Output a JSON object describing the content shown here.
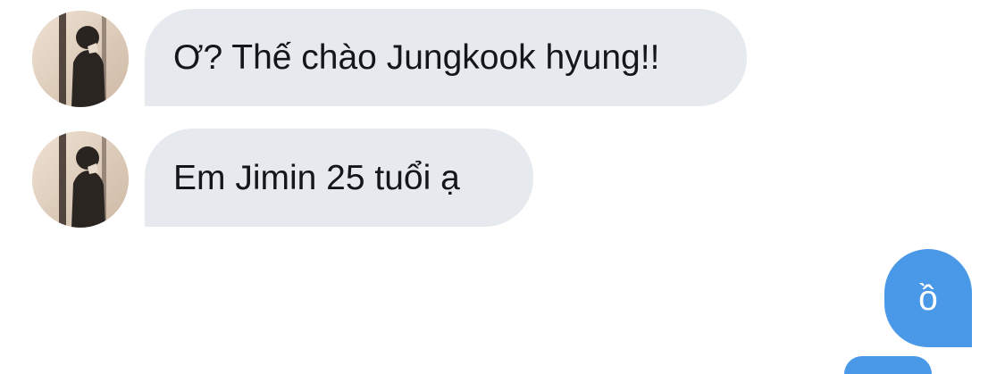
{
  "conversation": {
    "messages": [
      {
        "direction": "incoming",
        "text": "Ơ? Thế chào Jungkook hyung!!",
        "avatar": "user-avatar-photo"
      },
      {
        "direction": "incoming",
        "text": "Em Jimin 25 tuổi ạ",
        "avatar": "user-avatar-photo"
      },
      {
        "direction": "outgoing",
        "text": "ồ"
      }
    ]
  },
  "colors": {
    "incoming_bubble": "#e6e9ee",
    "outgoing_bubble": "#4a99e9",
    "incoming_text": "#14171a",
    "outgoing_text": "#ffffff",
    "background": "#ffffff"
  }
}
